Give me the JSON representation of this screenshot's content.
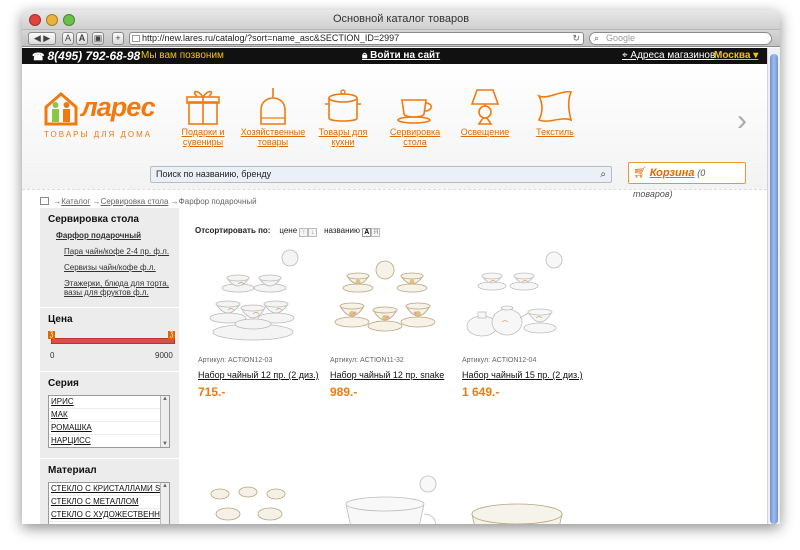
{
  "browser": {
    "title": "Основной каталог товаров",
    "url": "http://new.lares.ru/catalog/?sort=name_asc&SECTION_ID=2997",
    "search_placeholder": "Google"
  },
  "topbar": {
    "phone": "8(495) 792-68-98",
    "callback": "Мы вам позвоним",
    "login": "Войти на сайт",
    "shops": "Адреса магазинов",
    "city": "Москва ▾"
  },
  "header": {
    "logo_text": "ларес",
    "logo_sub": "ТОВАРЫ ДЛЯ ДОМА",
    "categories": [
      {
        "label": "Подарки и сувениры",
        "icon": "gift-icon"
      },
      {
        "label": "Хозяйственные товары",
        "icon": "dustpan-icon"
      },
      {
        "label": "Товары для кухни",
        "icon": "pot-icon"
      },
      {
        "label": "Сервировка стола",
        "icon": "teacup-icon"
      },
      {
        "label": "Освещение",
        "icon": "lamp-icon"
      },
      {
        "label": "Текстиль",
        "icon": "pillow-icon"
      }
    ],
    "search_placeholder": "Поиск по названию, бренду",
    "cart_label": "Корзина",
    "cart_count": "(0 товаров)"
  },
  "breadcrumb": {
    "items": [
      "Каталог",
      "Сервировка стола",
      "Фарфор подарочный"
    ]
  },
  "sidebar": {
    "section_title": "Сервировка стола",
    "active_item": "Фарфор подарочный",
    "sub_items": [
      "Пара чайн/кофе 2-4 пр. ф.л.",
      "Сервизы чайн/кофе ф.л.",
      "Этажерки, блюда для торта, вазы для фруктов ф.л."
    ],
    "price_title": "Цена",
    "price_min": "0",
    "price_max": "9000",
    "series_title": "Серия",
    "series": [
      "ИРИС",
      "МАК",
      "РОМАШКА",
      "НАРЦИСС"
    ],
    "material_title": "Материал",
    "materials": [
      "СТЕКЛО С КРИСТАЛЛАМИ SWAROVSKI",
      "СТЕКЛО С МЕТАЛЛОМ",
      "СТЕКЛО С ХУДОЖЕСТВЕННОЙ РОСПИСЬЮ"
    ]
  },
  "sort": {
    "label": "Отсортировать по:",
    "price": "цене",
    "name": "названию",
    "asc_glyph": "↑",
    "desc_glyph": "↓",
    "az": "А",
    "za": "Я"
  },
  "products": [
    {
      "sku": "Артикул: ACTION12-03",
      "name": "Набор чайный 12 пр. (2 диз.)",
      "price": "715.-"
    },
    {
      "sku": "Артикул: ACTION11-32",
      "name": "Набор чайный 12 пр. snake",
      "price": "989.-"
    },
    {
      "sku": "Артикул: ACTION12-04",
      "name": "Набор чайный 15 пр. (2 диз.)",
      "price": "1 649.-"
    }
  ],
  "colors": {
    "accent": "#f07a10",
    "topbar": "#111111",
    "callback": "#f0c200"
  }
}
